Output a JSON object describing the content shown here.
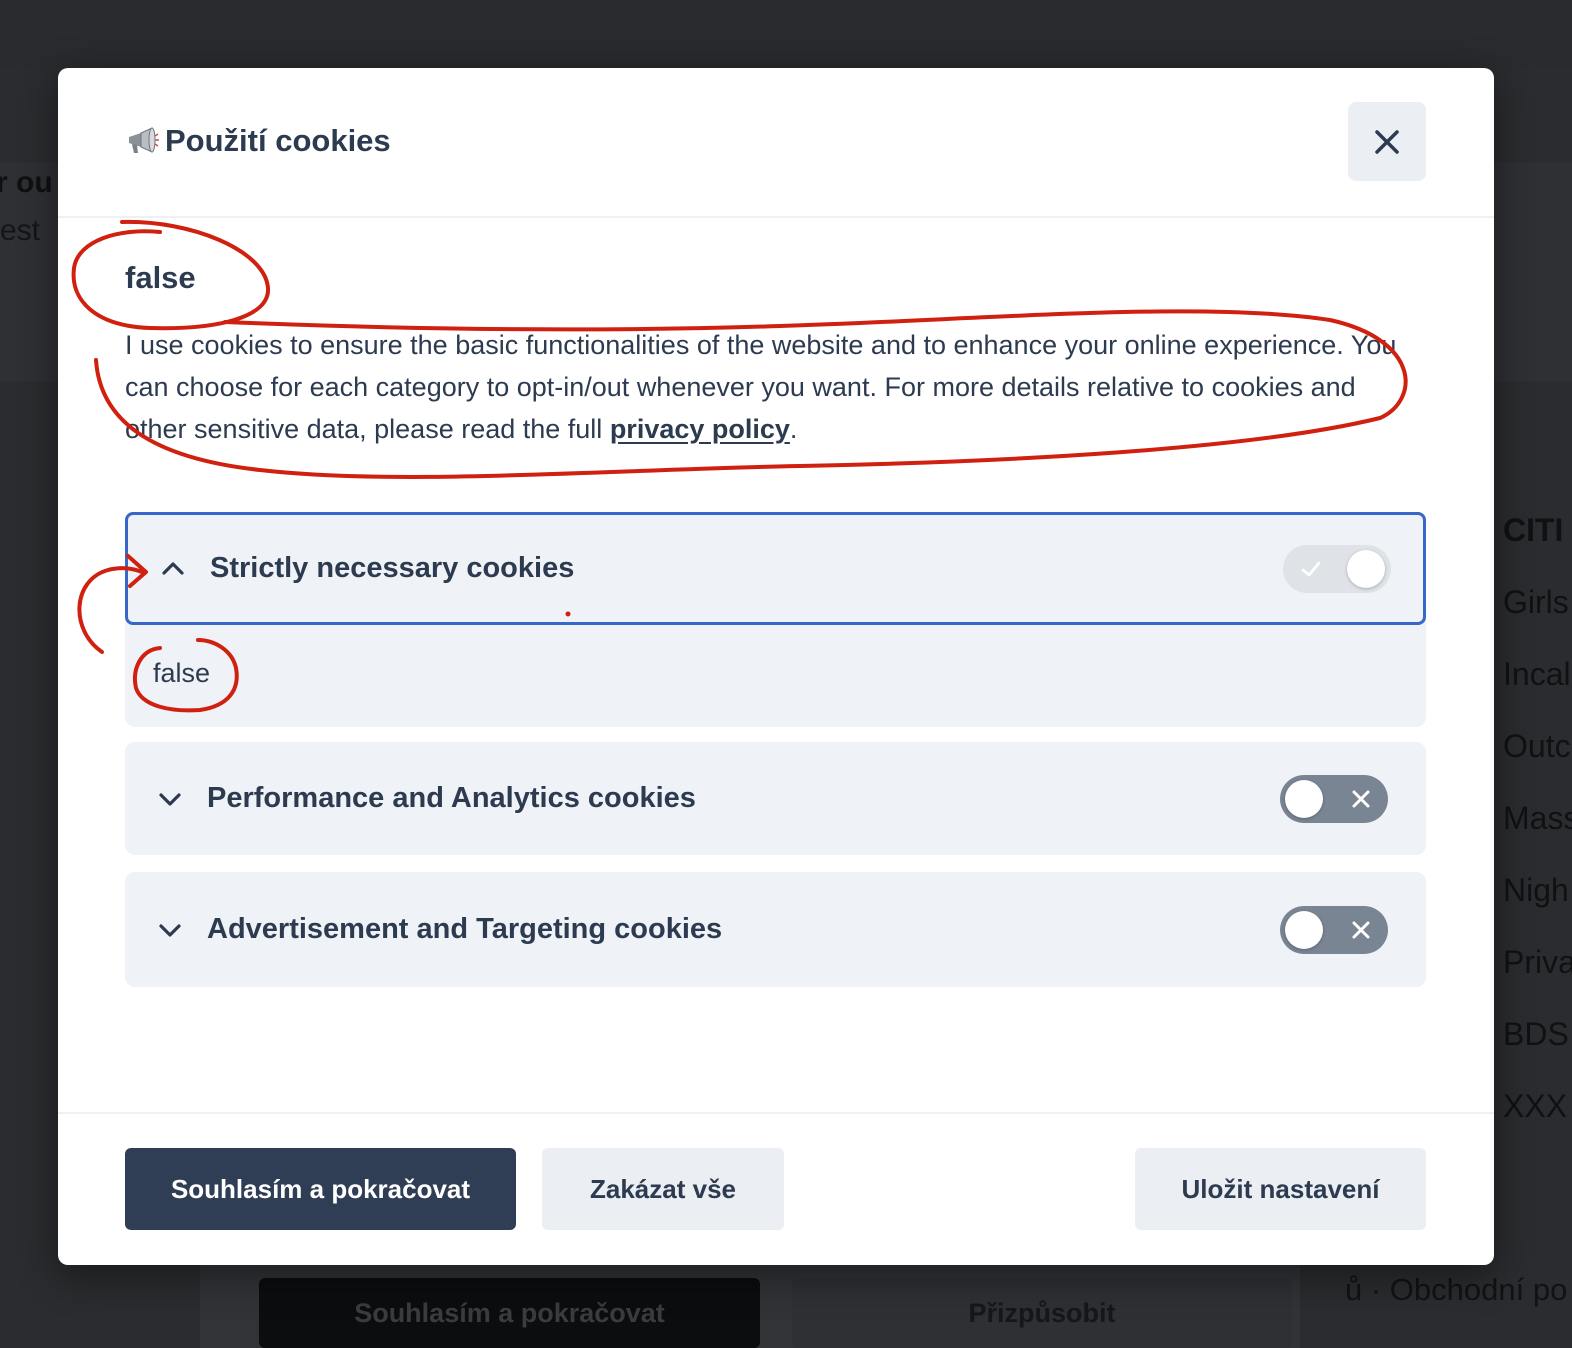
{
  "background_page": {
    "hero_fragments": [
      "r ou",
      "est "
    ],
    "sidebar": {
      "heading": "CITI",
      "items": [
        "Girls",
        "Incal",
        "Outc",
        "Mass",
        "Nigh",
        "Priva",
        "BDS",
        "XXX"
      ]
    },
    "footer_link": "ů · Obchodní po",
    "accept_button": "Souhlasím a pokračovat",
    "customize_button": "Přizpůsobit"
  },
  "modal": {
    "title": "Použití cookies",
    "icon": "megaphone-icon",
    "close_icon": "close-icon",
    "section_title": "false",
    "description_text": "I use cookies to ensure the basic functionalities of the website and to enhance your online experience. You can choose for each category to opt-in/out whenever you want. For more details relative to cookies and other sensitive data, please read the full ",
    "privacy_link": "privacy policy",
    "description_end": ".",
    "categories": [
      {
        "label": "Strictly necessary cookies",
        "expanded": true,
        "enabled": true,
        "disabled_toggle": true,
        "description": "false"
      },
      {
        "label": "Performance and Analytics cookies",
        "expanded": false,
        "enabled": false
      },
      {
        "label": "Advertisement and Targeting cookies",
        "expanded": false,
        "enabled": false
      }
    ],
    "buttons": {
      "accept": "Souhlasím a pokračovat",
      "reject": "Zakázat vše",
      "save": "Uložit nastavení"
    }
  },
  "colors": {
    "overlay": "#2b2c2f",
    "primary_button": "#2f3e55",
    "focus_outline": "#3767c8",
    "annotation": "#d0200f",
    "text": "#2d3b50"
  }
}
